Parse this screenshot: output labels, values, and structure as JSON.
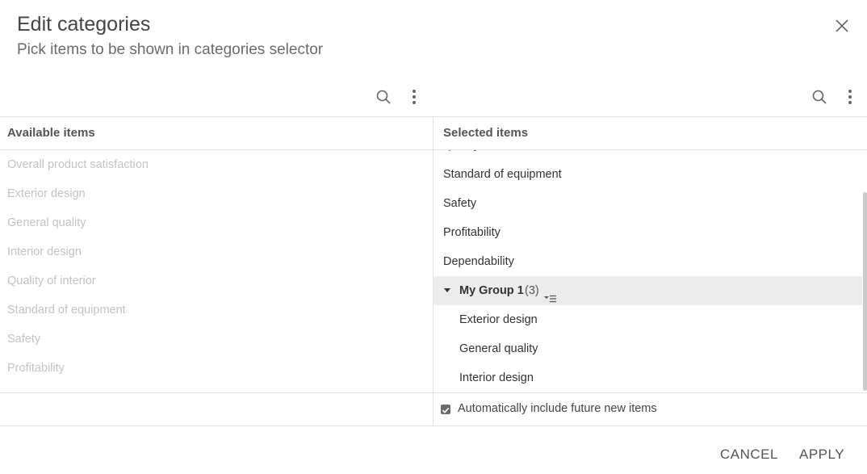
{
  "dialog": {
    "title": "Edit categories",
    "subtitle": "Pick items to be shown in categories selector"
  },
  "available": {
    "header": "Available items",
    "items": [
      "Overall product satisfaction",
      "Exterior design",
      "General quality",
      "Interior design",
      "Quality of interior",
      "Standard of equipment",
      "Safety",
      "Profitability"
    ]
  },
  "selected": {
    "header": "Selected items",
    "partial_item": "Quality",
    "items": [
      "Standard of equipment",
      "Safety",
      "Profitability",
      "Dependability"
    ],
    "group": {
      "name": "My Group 1",
      "count": "(3)",
      "children": [
        "Exterior design",
        "General quality",
        "Interior design"
      ]
    }
  },
  "options": {
    "auto_include_label": "Automatically include future new items",
    "auto_include_checked": true
  },
  "footer": {
    "cancel_label": "CANCEL",
    "apply_label": "APPLY"
  },
  "icons": {
    "close": "close-icon",
    "search": "search-icon",
    "more": "more-vertical-icon"
  },
  "colors": {
    "group_highlight": "#ececec",
    "available_text": "#c3c3c3",
    "checkbox": "#6a6a6a"
  }
}
